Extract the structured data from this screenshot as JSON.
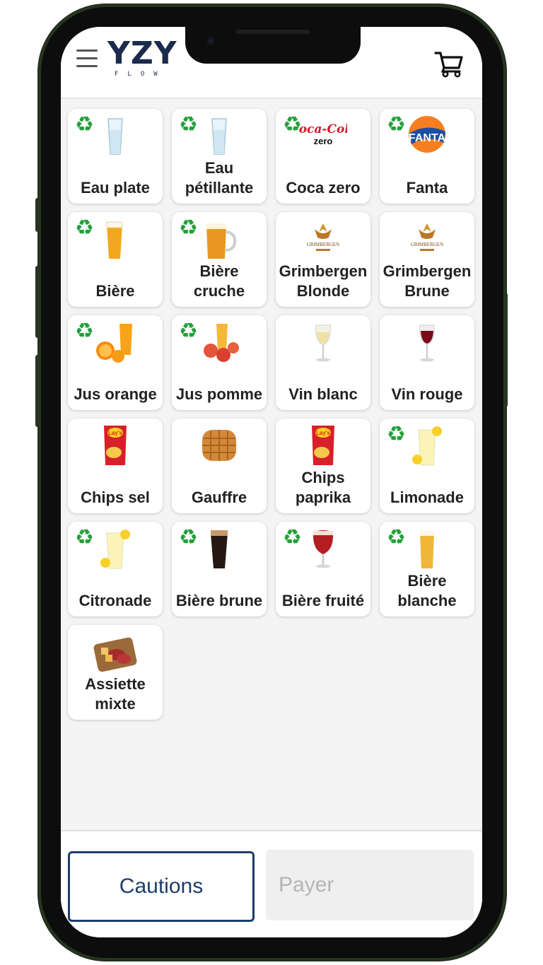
{
  "logo": {
    "main": "YZY",
    "sub": "FLOW"
  },
  "icons": {
    "menu": "hamburger-menu-icon",
    "cart": "shopping-cart-icon",
    "recycle": "recycle-icon"
  },
  "products": [
    {
      "label": "Eau plate",
      "recyclable": true,
      "image": "glass-of-water"
    },
    {
      "label": "Eau pétillante",
      "recyclable": true,
      "image": "glass-of-water"
    },
    {
      "label": "Coca zero",
      "recyclable": true,
      "image": "coca-cola-zero-logo"
    },
    {
      "label": "Fanta",
      "recyclable": true,
      "image": "fanta-logo"
    },
    {
      "label": "Bière",
      "recyclable": true,
      "image": "beer-glass"
    },
    {
      "label": "Bière cruche",
      "recyclable": true,
      "image": "beer-pitcher"
    },
    {
      "label": "Grimbergen Blonde",
      "recyclable": false,
      "image": "grimbergen-logo"
    },
    {
      "label": "Grimbergen Brune",
      "recyclable": false,
      "image": "grimbergen-logo"
    },
    {
      "label": "Jus orange",
      "recyclable": true,
      "image": "orange-juice"
    },
    {
      "label": "Jus pomme",
      "recyclable": true,
      "image": "apple-juice"
    },
    {
      "label": "Vin blanc",
      "recyclable": false,
      "image": "white-wine-glass"
    },
    {
      "label": "Vin rouge",
      "recyclable": false,
      "image": "red-wine-glass"
    },
    {
      "label": "Chips sel",
      "recyclable": false,
      "image": "lays-chips-bag"
    },
    {
      "label": "Gauffre",
      "recyclable": false,
      "image": "waffle"
    },
    {
      "label": "Chips paprika",
      "recyclable": false,
      "image": "lays-chips-bag"
    },
    {
      "label": "Limonade",
      "recyclable": true,
      "image": "lemonade-glass"
    },
    {
      "label": "Citronade",
      "recyclable": true,
      "image": "lemonade-glass"
    },
    {
      "label": "Bière brune",
      "recyclable": true,
      "image": "dark-beer-glass"
    },
    {
      "label": "Bière fruité",
      "recyclable": true,
      "image": "fruit-beer-glass"
    },
    {
      "label": "Bière blanche",
      "recyclable": true,
      "image": "white-beer-glass"
    },
    {
      "label": "Assiette mixte",
      "recyclable": false,
      "image": "charcuterie-board"
    }
  ],
  "footer": {
    "cautions_label": "Cautions",
    "payer_label": "Payer"
  },
  "colors": {
    "primary": "#1c3e6a",
    "recycle": "#23a03a",
    "disabled_bg": "#efefef",
    "disabled_text": "#b5b5b5"
  }
}
